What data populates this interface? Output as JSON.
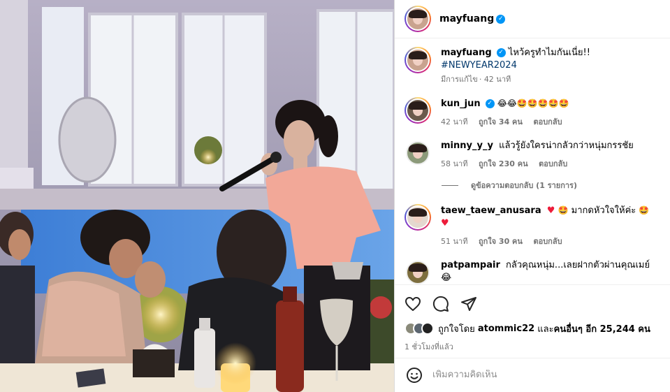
{
  "post": {
    "author": "mayfuang",
    "verified": true
  },
  "caption": {
    "username": "mayfuang",
    "text": "ไหว้ครูทำไมกันเนี่ย!!",
    "hashtag": "#NEWYEAR2024",
    "edited_label": "มีการแก้ไข",
    "time": "42 นาที"
  },
  "comments": [
    {
      "username": "kun_jun",
      "verified": true,
      "text": "😂😂🤩🤩🤩🤩🤩",
      "time": "42 นาที",
      "likes": "ถูกใจ 34 คน",
      "reply": "ตอบกลับ"
    },
    {
      "username": "minny_y_y",
      "verified": false,
      "text": "แล้วรู้ยังใครน่ากลัวกว่าหนุ่มกรรชัย",
      "time": "58 นาที",
      "likes": "ถูกใจ 230 คน",
      "reply": "ตอบกลับ",
      "view_replies": "ดูข้อความตอบกลับ (1 รายการ)"
    },
    {
      "username": "taew_taew_anusara",
      "verified": false,
      "text_before": "🤩",
      "text": "มากดหัวใจให้ค่ะ",
      "text_after": "🤩",
      "time": "51 นาที",
      "likes": "ถูกใจ 30 คน",
      "reply": "ตอบกลับ"
    },
    {
      "username": "patpampair",
      "verified": false,
      "text": "กลัวคุณหนุ่ม...เลยฝากตัวผ่านคุณเมย์😂"
    }
  ],
  "actions": {
    "like_icon": "heart-outline-icon",
    "comment_icon": "comment-bubble-icon",
    "share_icon": "paper-plane-icon"
  },
  "likes_summary": {
    "prefix": "ถูกใจโดย",
    "first_user": "atommic22",
    "middle": "และ",
    "others": "คนอื่นๆ อีก 25,244 คน"
  },
  "posted_time": "1 ชั่วโมงที่แล้ว",
  "add_comment": {
    "placeholder": "เพิ่มความคิดเห็น",
    "emoji_icon": "smiley-icon"
  },
  "colors": {
    "verified": "#0095f6",
    "link": "#00376b",
    "muted": "#737373"
  }
}
